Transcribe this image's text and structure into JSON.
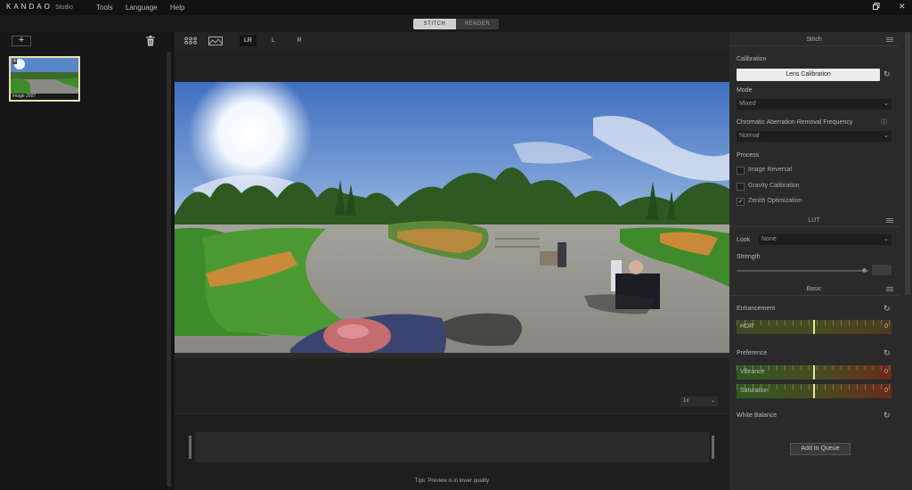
{
  "app": {
    "logo": "KANDAO",
    "logo_suffix": "Studio",
    "menu": [
      "Tools",
      "Language",
      "Help"
    ]
  },
  "mode_toggle": {
    "stitch": "STITCH",
    "render": "RENDER"
  },
  "left_panel": {
    "thumbnail": {
      "badge": "4",
      "label": "image 2007"
    }
  },
  "toolbar": {
    "views": [
      "LR",
      "L",
      "R"
    ],
    "active": "LR"
  },
  "zoom": {
    "value": "1x"
  },
  "footer": {
    "preview_note": "Tips: Preview is in lower quality"
  },
  "right_panel": {
    "stitch": {
      "title": "Stitch",
      "calibration_label": "Calibration",
      "lens_calibration_button": "Lens Calibration",
      "mode_label": "Mode",
      "mode_value": "Mixed",
      "chromatic_label": "Chromatic Aberration Removal Frequency",
      "chromatic_value": "Normal",
      "process_label": "Process",
      "options": [
        {
          "label": "Image Reversal",
          "checked": false
        },
        {
          "label": "Gravity Calibration",
          "checked": false
        },
        {
          "label": "Zenith Optimization",
          "checked": true
        }
      ]
    },
    "lut": {
      "title": "LUT",
      "look_label": "Look",
      "look_value": "None",
      "strength_label": "Strength",
      "strength_value": ""
    },
    "basic": {
      "title": "Basic",
      "enhancement_label": "Enhancement",
      "hdr": {
        "label": "HDR",
        "value": "0"
      },
      "preference_label": "Preference",
      "vibrance": {
        "label": "Vibrance",
        "value": "0"
      },
      "saturation": {
        "label": "Saturation",
        "value": "0"
      },
      "white_balance_label": "White Balance"
    },
    "queue_button": "Add to Queue"
  },
  "colors": {
    "accent": "#e6e6a0",
    "sky": "#4a78c4",
    "grass": "#3f8a2a"
  }
}
